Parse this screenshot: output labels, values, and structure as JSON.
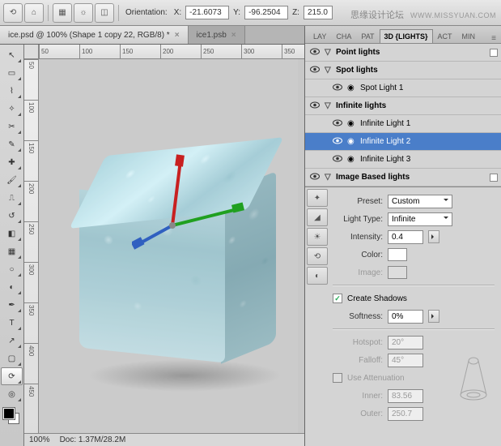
{
  "watermark_en": "WWW.MISSYUAN.COM",
  "watermark_cn": "思缘设计论坛",
  "options": {
    "orientation_label": "Orientation:",
    "x_lbl": "X:",
    "x_val": "-21.6073",
    "y_lbl": "Y:",
    "y_val": "-96.2504",
    "z_lbl": "Z:",
    "z_val": "215.0"
  },
  "tabs": [
    {
      "label": "ice.psd @ 100% (Shape 1 copy 22, RGB/8) *",
      "active": true
    },
    {
      "label": "ice1.psb",
      "active": false
    }
  ],
  "ruler_h": [
    "50",
    "100",
    "150",
    "200",
    "250",
    "300",
    "350"
  ],
  "ruler_v": [
    "50",
    "100",
    "150",
    "200",
    "250",
    "300",
    "350",
    "400",
    "450"
  ],
  "status": {
    "zoom": "100%",
    "doc": "Doc: 1.37M/28.2M"
  },
  "panel_tabs": [
    "LAY",
    "CHA",
    "PAT",
    "3D {LIGHTS}",
    "ACT",
    "MIN"
  ],
  "panel_active": 3,
  "lights": {
    "groups": [
      {
        "name": "Point lights",
        "expanded": false,
        "children": []
      },
      {
        "name": "Spot lights",
        "expanded": true,
        "children": [
          {
            "name": "Spot Light 1",
            "sel": false
          }
        ]
      },
      {
        "name": "Infinite lights",
        "expanded": true,
        "children": [
          {
            "name": "Infinite Light 1",
            "sel": false
          },
          {
            "name": "Infinite Light 2",
            "sel": true
          },
          {
            "name": "Infinite Light 3",
            "sel": false
          }
        ]
      },
      {
        "name": "Image Based lights",
        "expanded": false,
        "children": []
      }
    ]
  },
  "props": {
    "preset_lbl": "Preset:",
    "preset_val": "Custom",
    "type_lbl": "Light Type:",
    "type_val": "Infinite",
    "intensity_lbl": "Intensity:",
    "intensity_val": "0.4",
    "color_lbl": "Color:",
    "image_lbl": "Image:",
    "shadows_lbl": "Create Shadows",
    "shadows_chk": true,
    "softness_lbl": "Softness:",
    "softness_val": "0%",
    "hotspot_lbl": "Hotspot:",
    "hotspot_val": "20°",
    "falloff_lbl": "Falloff:",
    "falloff_val": "45°",
    "atten_lbl": "Use Attenuation",
    "inner_lbl": "Inner:",
    "inner_val": "83.56",
    "outer_lbl": "Outer:",
    "outer_val": "250.7"
  }
}
